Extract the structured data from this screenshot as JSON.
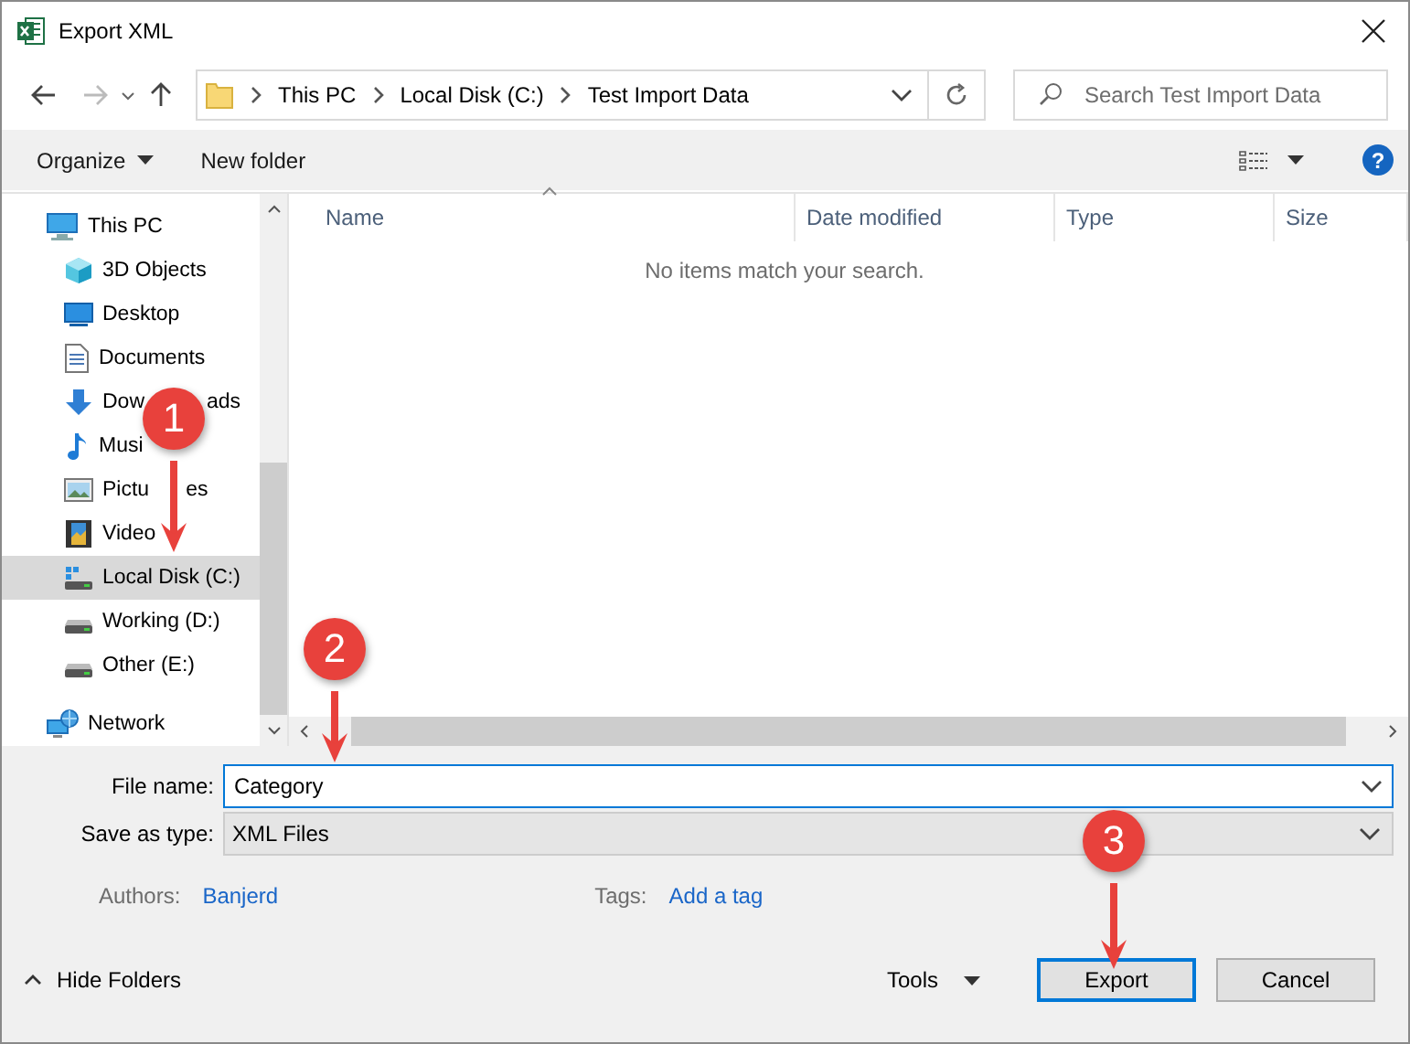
{
  "window": {
    "title": "Export XML"
  },
  "address_bar": {
    "crumbs": [
      "This PC",
      "Local Disk (C:)",
      "Test Import Data"
    ]
  },
  "search": {
    "placeholder": "Search Test Import Data"
  },
  "toolbar": {
    "organize": "Organize",
    "new_folder": "New folder",
    "help": "?"
  },
  "sidebar": {
    "items": [
      {
        "label": "This PC",
        "kind": "pc",
        "selected": false,
        "children": [
          {
            "label": "3D Objects",
            "kind": "objects3d",
            "selected": false
          },
          {
            "label": "Desktop",
            "kind": "desktop",
            "selected": false
          },
          {
            "label": "Documents",
            "kind": "documents",
            "selected": false
          },
          {
            "label": "Dow",
            "label_tail": "ads",
            "kind": "downloads",
            "selected": false
          },
          {
            "label": "Musi",
            "kind": "music",
            "selected": false
          },
          {
            "label": "Pictu",
            "label_tail": "es",
            "kind": "pictures",
            "selected": false
          },
          {
            "label": "Video",
            "kind": "videos",
            "selected": false
          },
          {
            "label": "Local Disk (C:)",
            "kind": "system_drive",
            "selected": true
          },
          {
            "label": "Working (D:)",
            "kind": "drive",
            "selected": false
          },
          {
            "label": "Other (E:)",
            "kind": "drive",
            "selected": false
          }
        ]
      },
      {
        "label": "Network",
        "kind": "network",
        "selected": false
      }
    ]
  },
  "table": {
    "columns": [
      "Name",
      "Date modified",
      "Type",
      "Size"
    ],
    "empty_message": "No items match your search."
  },
  "form": {
    "file_name_label": "File name:",
    "file_name": "Category",
    "type_label": "Save as type:",
    "type": "XML Files",
    "authors_label": "Authors:",
    "authors": "Banjerd",
    "tags_label": "Tags:",
    "tags_placeholder": "Add a tag"
  },
  "footer": {
    "hide_folders": "Hide Folders",
    "tools": "Tools",
    "export": "Export",
    "cancel": "Cancel"
  },
  "annotations": [
    {
      "number": "1"
    },
    {
      "number": "2"
    },
    {
      "number": "3"
    }
  ]
}
